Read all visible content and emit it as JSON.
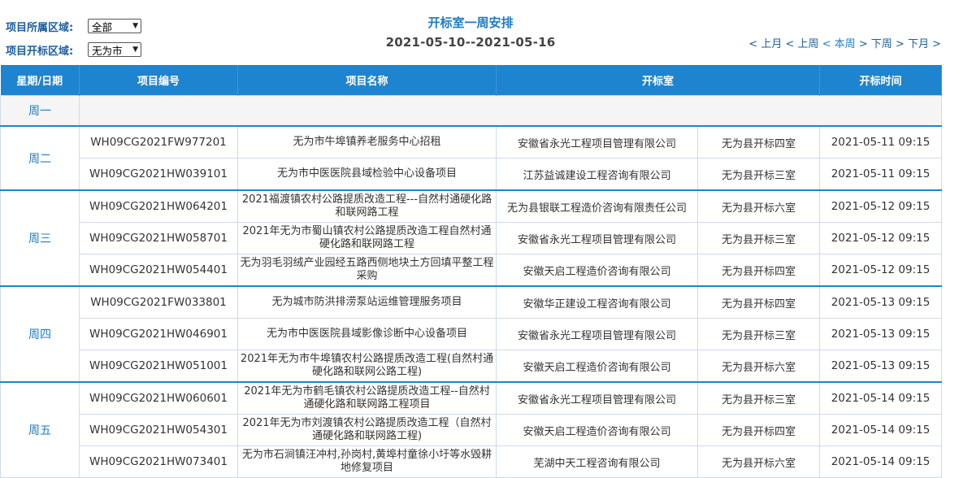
{
  "filters": {
    "region_label": "项目所属区域:",
    "region_value": "全部",
    "bid_region_label": "项目开标区域:",
    "bid_region_value": "无为市"
  },
  "header": {
    "title": "开标室一周安排",
    "date_range": "2021-05-10--2021-05-16"
  },
  "nav": {
    "prev_month": "< 上月",
    "prev_week": "< 上周",
    "this_week": "< 本周",
    "next_week": "> 下周",
    "next_month": "> 下月",
    "trailing": ">"
  },
  "table": {
    "columns": [
      "星期/日期",
      "项目编号",
      "项目名称",
      "开标室",
      "开标时间"
    ],
    "days": [
      {
        "label": "周一",
        "rows": []
      },
      {
        "label": "周二",
        "rows": [
          {
            "code": "WH09CG2021FW977201",
            "name": "无为市牛埠镇养老服务中心招租",
            "org": "安徽省永光工程项目管理有限公司",
            "room": "无为县开标四室",
            "time": "2021-05-11 09:15"
          },
          {
            "code": "WH09CG2021HW039101",
            "name": "无为市中医医院县域检验中心设备项目",
            "org": "江苏益诚建设工程咨询有限公司",
            "room": "无为县开标三室",
            "time": "2021-05-11 09:15"
          }
        ]
      },
      {
        "label": "周三",
        "rows": [
          {
            "code": "WH09CG2021HW064201",
            "name": "2021福渡镇农村公路提质改造工程---自然村通硬化路和联网路工程",
            "org": "无为县银联工程造价咨询有限责任公司",
            "room": "无为县开标六室",
            "time": "2021-05-12 09:15"
          },
          {
            "code": "WH09CG2021HW058701",
            "name": "2021年无为市蜀山镇农村公路提质改造工程自然村通硬化路和联网路工程",
            "org": "安徽省永光工程项目管理有限公司",
            "room": "无为县开标三室",
            "time": "2021-05-12 09:15"
          },
          {
            "code": "WH09CG2021HW054401",
            "name": "无为羽毛羽绒产业园经五路西侧地块土方回填平整工程采购",
            "org": "安徽天启工程造价咨询有限公司",
            "room": "无为县开标四室",
            "time": "2021-05-12 09:15"
          }
        ]
      },
      {
        "label": "周四",
        "rows": [
          {
            "code": "WH09CG2021FW033801",
            "name": "无为城市防洪排涝泵站运维管理服务项目",
            "org": "安徽华正建设工程咨询有限公司",
            "room": "无为县开标四室",
            "time": "2021-05-13 09:15"
          },
          {
            "code": "WH09CG2021HW046901",
            "name": "无为市中医医院县域影像诊断中心设备项目",
            "org": "安徽省永光工程项目管理有限公司",
            "room": "无为县开标三室",
            "time": "2021-05-13 09:15"
          },
          {
            "code": "WH09CG2021HW051001",
            "name": "2021年无为市牛埠镇农村公路提质改造工程(自然村通硬化路和联网公路工程)",
            "org": "安徽天启工程造价咨询有限公司",
            "room": "无为县开标六室",
            "time": "2021-05-13 09:15"
          }
        ]
      },
      {
        "label": "周五",
        "rows": [
          {
            "code": "WH09CG2021HW060601",
            "name": "2021年无为市鹤毛镇农村公路提质改造工程--自然村通硬化路和联网路工程项目",
            "org": "安徽省永光工程项目管理有限公司",
            "room": "无为县开标三室",
            "time": "2021-05-14 09:15"
          },
          {
            "code": "WH09CG2021HW054301",
            "name": "2021年无为市刘渡镇农村公路提质改造工程（自然村通硬化路和联网路工程)",
            "org": "安徽天启工程造价咨询有限公司",
            "room": "无为县开标四室",
            "time": "2021-05-14 09:15"
          },
          {
            "code": "WH09CG2021HW073401",
            "name": "无为市石涧镇汪冲村,孙岗村,黄埠村童徐小圩等水毁耕地修复项目",
            "org": "芜湖中天工程咨询有限公司",
            "room": "无为县开标六室",
            "time": "2021-05-14 09:15"
          }
        ]
      }
    ]
  }
}
